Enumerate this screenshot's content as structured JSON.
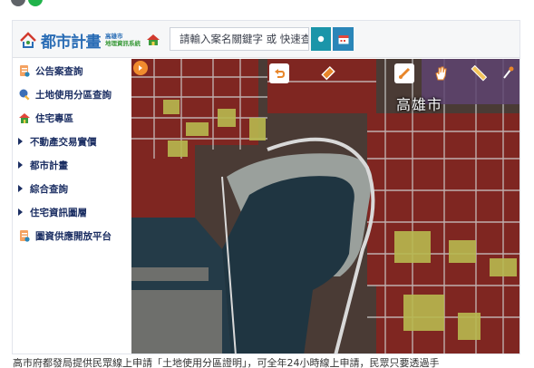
{
  "window": {
    "dots": [
      "gray",
      "green"
    ]
  },
  "header": {
    "logo_main": "都市計畫",
    "logo_sub_top": "高雄市",
    "logo_sub_bottom": "地理資訊系統",
    "search_placeholder": "請輸入案名關鍵字 或 快速查"
  },
  "sidebar": {
    "items": [
      {
        "label": "公告案查詢",
        "icon": "document-icon"
      },
      {
        "label": "土地使用分區查詢",
        "icon": "magnifier-icon"
      },
      {
        "label": "住宅專區",
        "icon": "house-icon"
      },
      {
        "label": "不動產交易實價",
        "icon": "triangle-icon"
      },
      {
        "label": "都市計畫",
        "icon": "triangle-icon"
      },
      {
        "label": "綜合查詢",
        "icon": "triangle-icon"
      },
      {
        "label": "住宅資訊圖層",
        "icon": "triangle-icon"
      },
      {
        "label": "圖資供應開放平台",
        "icon": "document-icon"
      }
    ]
  },
  "map": {
    "city_label": "高雄市",
    "colors": {
      "residential": "#8a2a24",
      "commercial": "#c3c35a",
      "water": "#1f3541",
      "park": "#9aa09c"
    },
    "tools": [
      "collapse-arrow-icon",
      "back-icon",
      "eraser-icon",
      "measure-icon",
      "pan-hand-icon",
      "ruler-icon",
      "pin-icon"
    ]
  },
  "footer": {
    "text": "高市府都發局提供民眾線上申請「土地使用分區證明」，可全年24小時線上申請，民眾只要透過手"
  }
}
